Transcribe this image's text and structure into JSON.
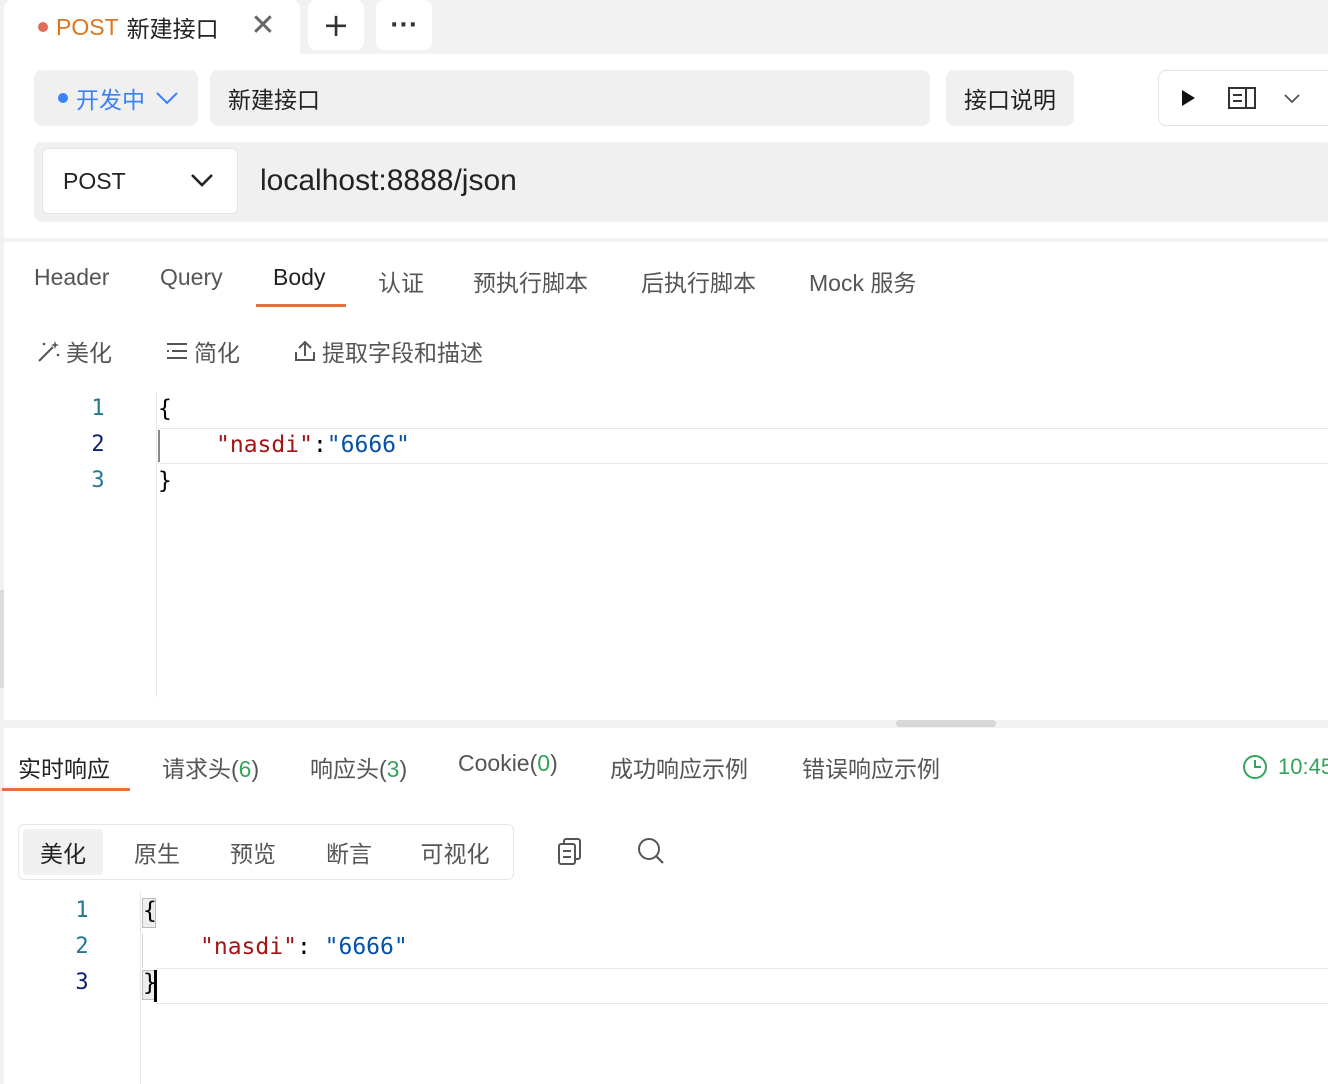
{
  "tab": {
    "method": "POST",
    "name": "新建接口",
    "close": "✕"
  },
  "tabstrip": {
    "add": "+",
    "more": "···"
  },
  "request": {
    "status": "开发中",
    "name_value": "新建接口",
    "desc_button": "接口说明",
    "method": "POST",
    "url": "localhost:8888/json"
  },
  "body_tabs": [
    "Header",
    "Query",
    "Body",
    "认证",
    "预执行脚本",
    "后执行脚本",
    "Mock 服务"
  ],
  "body_toolbar": {
    "beautify": "美化",
    "simplify": "简化",
    "extract": "提取字段和描述"
  },
  "body_editor": {
    "line_numbers": [
      "1",
      "2",
      "3"
    ],
    "line1": "{",
    "key": "\"nasdi\"",
    "colon": ":",
    "value": "\"6666\"",
    "line3": "}"
  },
  "response_tabs": {
    "realtime": "实时响应",
    "req_headers": "请求头(",
    "req_headers_count": "6",
    "resp_headers": "响应头(",
    "resp_headers_count": "3",
    "cookie": "Cookie(",
    "cookie_count": "0",
    "close_paren": ")",
    "success_example": "成功响应示例",
    "error_example": "错误响应示例"
  },
  "response_time": "10:45",
  "response_view": [
    "美化",
    "原生",
    "预览",
    "断言",
    "可视化"
  ],
  "response_editor": {
    "line_numbers": [
      "1",
      "2",
      "3"
    ],
    "line1": "{",
    "key": "\"nasdi\"",
    "colon": ": ",
    "value": "\"6666\"",
    "line3": "}"
  },
  "colors": {
    "accent": "#e76f3c",
    "blue": "#3a82f7",
    "green": "#35a35a"
  }
}
